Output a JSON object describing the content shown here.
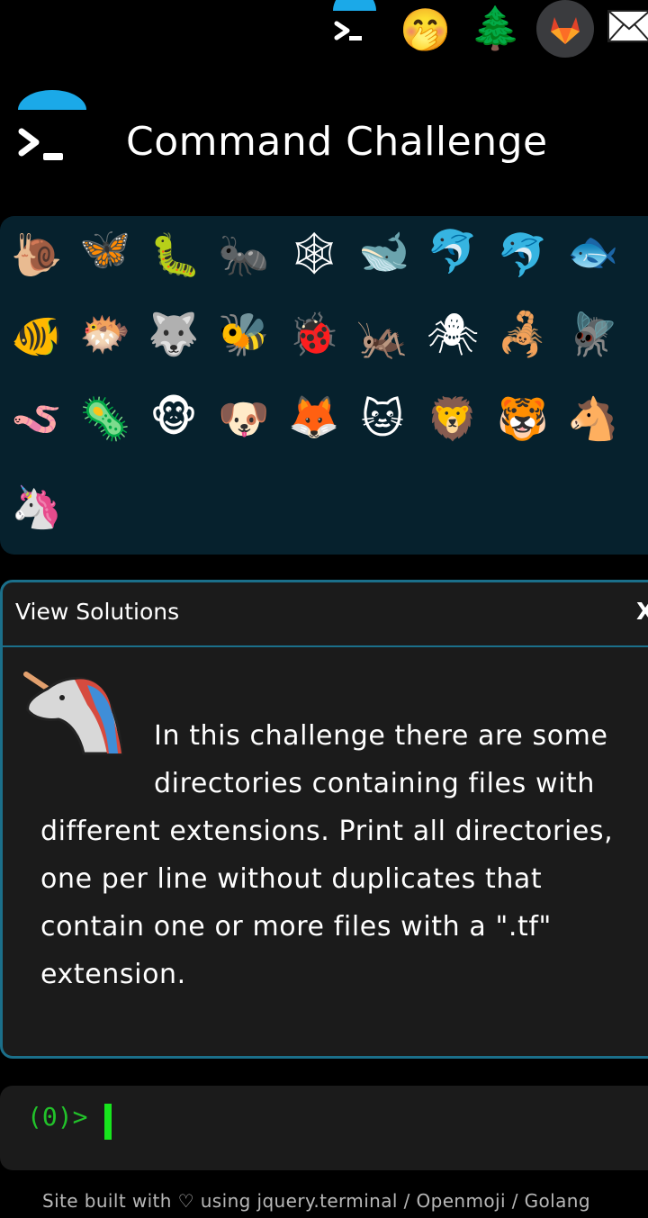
{
  "header": {
    "title": "Command Challenge"
  },
  "top_icons": [
    {
      "name": "terminal-icon",
      "glyph": ""
    },
    {
      "name": "shushing-face-icon",
      "glyph": "🤭"
    },
    {
      "name": "christmas-tree-icon",
      "glyph": "🌲"
    },
    {
      "name": "gitlab-icon",
      "glyph": ""
    },
    {
      "name": "mail-icon",
      "glyph": ""
    }
  ],
  "animals": [
    [
      "🐌",
      "🦋",
      "🐛",
      "🐜",
      "🕸",
      "🐋",
      "🐬",
      "🐬",
      "🐟"
    ],
    [
      "🐠",
      "🐡",
      "🐺",
      "🐝",
      "🐞",
      "🦗",
      "🕷",
      "🦂",
      "🪰"
    ],
    [
      "🪱",
      "🦠",
      "🐵",
      "🐶",
      "🦊",
      "🐱",
      "🦁",
      "🐯",
      "🐴"
    ],
    [
      "🦄"
    ]
  ],
  "solutions": {
    "title": "View Solutions",
    "close_label": "X",
    "description": "In this challenge there are some directories containing files with different extensions. Print all directories, one per line without duplicates that contain one or more files with a \".tf\" extension."
  },
  "terminal": {
    "prompt": "(0)>"
  },
  "footer": {
    "text": "Site built with ♡ using jquery.terminal / Openmoji / Golang"
  },
  "colors": {
    "accent_blue": "#1ba9e8",
    "panel_border": "#1b6f8a",
    "grid_bg": "#06212d",
    "prompt_green": "#22c32a"
  }
}
